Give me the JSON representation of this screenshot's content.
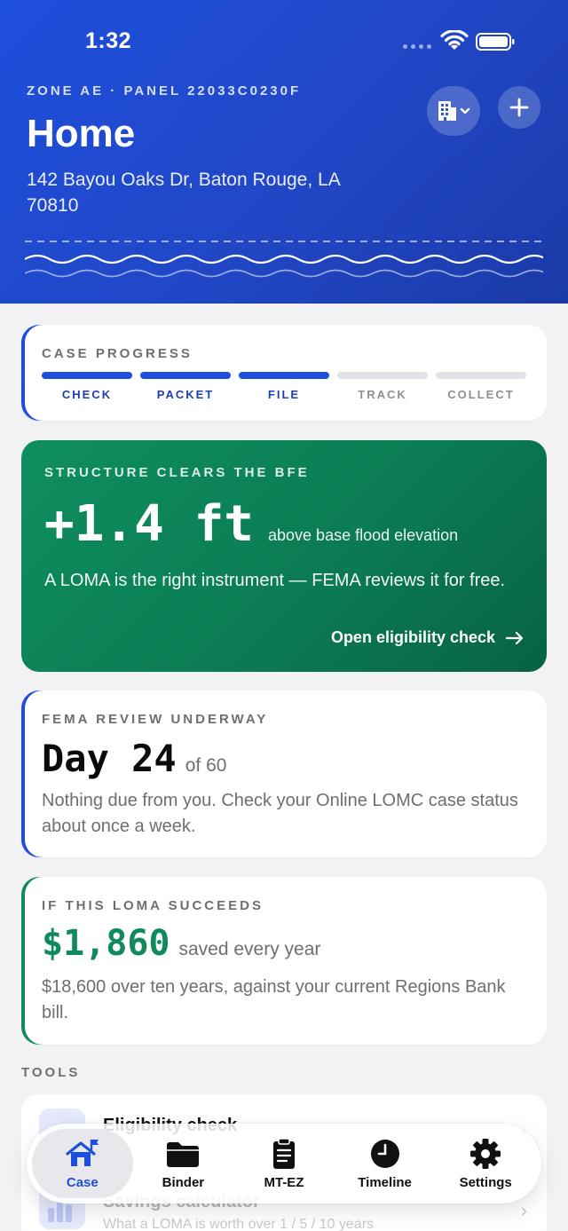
{
  "status": {
    "time": "1:32"
  },
  "header": {
    "zone_panel": "ZONE AE · PANEL 22033C0230F",
    "title": "Home",
    "address": "142 Bayou Oaks Dr, Baton Rouge, LA 70810"
  },
  "progress": {
    "label": "CASE PROGRESS",
    "steps": [
      {
        "label": "CHECK",
        "done": true
      },
      {
        "label": "PACKET",
        "done": true
      },
      {
        "label": "FILE",
        "done": true
      },
      {
        "label": "TRACK",
        "done": false
      },
      {
        "label": "COLLECT",
        "done": false
      }
    ]
  },
  "bfe": {
    "label": "STRUCTURE CLEARS THE BFE",
    "value": "+1.4 ft",
    "unit": "above base flood elevation",
    "description": "A LOMA is the right instrument — FEMA reviews it for free.",
    "link": "Open eligibility check"
  },
  "review": {
    "label": "FEMA REVIEW UNDERWAY",
    "day": "Day 24",
    "of": "of 60",
    "description": "Nothing due from you. Check your Online LOMC case status about once a week."
  },
  "savings": {
    "label": "IF THIS LOMA SUCCEEDS",
    "amount": "$1,860",
    "unit": "saved every year",
    "description": "$18,600 over ten years, against your current Regions Bank bill."
  },
  "tools": {
    "label": "TOOLS",
    "items": [
      {
        "title": "Eligibility check",
        "subtitle": ""
      },
      {
        "title": "Savings calculator",
        "subtitle": "What a LOMA is worth over 1 / 5 / 10 years"
      }
    ]
  },
  "tabbar": {
    "tabs": [
      {
        "label": "Case",
        "icon": "house-flag-icon",
        "active": true
      },
      {
        "label": "Binder",
        "icon": "folder-icon",
        "active": false
      },
      {
        "label": "MT-EZ",
        "icon": "clipboard-icon",
        "active": false
      },
      {
        "label": "Timeline",
        "icon": "clock-icon",
        "active": false
      },
      {
        "label": "Settings",
        "icon": "gear-icon",
        "active": false
      }
    ]
  },
  "colors": {
    "brand_blue": "#1e4fdc",
    "success_green": "#118a5b",
    "background": "#f2f2f5"
  }
}
